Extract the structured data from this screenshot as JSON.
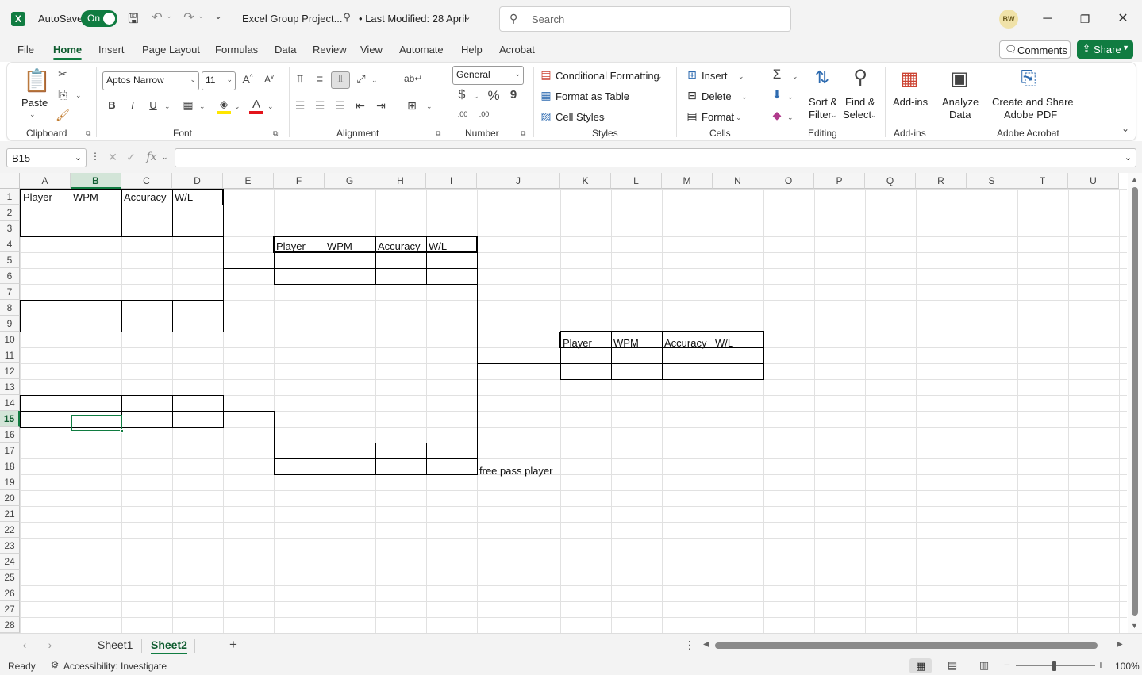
{
  "titlebar": {
    "autosave_label": "AutoSave",
    "autosave_state": "On",
    "file_name": "Excel Group Project...",
    "last_modified": "• Last Modified: 28 April",
    "search_placeholder": "Search",
    "user_initials": "BW",
    "excel_logo": "X"
  },
  "menu_tabs": [
    "File",
    "Home",
    "Insert",
    "Page Layout",
    "Formulas",
    "Data",
    "Review",
    "View",
    "Automate",
    "Help",
    "Acrobat"
  ],
  "active_tab": "Home",
  "comments_label": "Comments",
  "share_label": "Share",
  "ribbon": {
    "clipboard": {
      "paste": "Paste",
      "label": "Clipboard"
    },
    "font": {
      "name": "Aptos Narrow",
      "size": "11",
      "label": "Font",
      "bold": "B",
      "italic": "I",
      "underline": "U",
      "font_color": "A"
    },
    "alignment": {
      "label": "Alignment"
    },
    "number": {
      "format": "General",
      "label": "Number",
      "currency": "$",
      "percent": "%",
      "comma": "9",
      "inc_decimal": ".00",
      "dec_decimal": ".00"
    },
    "styles": {
      "conditional": "Conditional Formatting",
      "format_table": "Format as Table",
      "cell_styles": "Cell Styles",
      "label": "Styles"
    },
    "cells": {
      "insert": "Insert",
      "delete": "Delete",
      "format": "Format",
      "label": "Cells"
    },
    "editing": {
      "autosum": "Σ",
      "sort_filter_1": "Sort &",
      "sort_filter_2": "Filter",
      "find_select_1": "Find &",
      "find_select_2": "Select",
      "label": "Editing"
    },
    "addins": {
      "addins": "Add-ins",
      "label": "Add-ins"
    },
    "analyze": {
      "line1": "Analyze",
      "line2": "Data"
    },
    "acrobat": {
      "line1": "Create and Share",
      "line2": "Adobe PDF",
      "label": "Adobe Acrobat"
    }
  },
  "formula_bar": {
    "name_box": "B15",
    "fx": "fx",
    "value": ""
  },
  "columns": [
    "A",
    "B",
    "C",
    "D",
    "E",
    "F",
    "G",
    "H",
    "I",
    "J",
    "K",
    "L",
    "M",
    "N",
    "O",
    "P",
    "Q",
    "R",
    "S",
    "T",
    "U"
  ],
  "selected_column": "B",
  "rows": [
    "1",
    "2",
    "3",
    "4",
    "5",
    "6",
    "7",
    "8",
    "9",
    "10",
    "11",
    "12",
    "13",
    "14",
    "15",
    "16",
    "17",
    "18",
    "19",
    "20",
    "21",
    "22",
    "23",
    "24",
    "25",
    "26",
    "27",
    "28"
  ],
  "selected_row": "15",
  "cells": {
    "A1": "Player",
    "B1": "WPM",
    "C1": "Accuracy",
    "D1": "W/L",
    "F4": "Player",
    "G4": "WPM",
    "H4": "Accuracy",
    "I4": "W/L",
    "K10": "Player",
    "L10": "WPM",
    "M10": "Accuracy",
    "N10": "W/L",
    "J18": "free pass player"
  },
  "sheets": [
    "Sheet1",
    "Sheet2"
  ],
  "active_sheet": "Sheet2",
  "status": {
    "ready": "Ready",
    "accessibility": "Accessibility: Investigate",
    "zoom": "100%"
  },
  "colors": {
    "accent": "#107c41",
    "share_bg": "#107c41"
  }
}
